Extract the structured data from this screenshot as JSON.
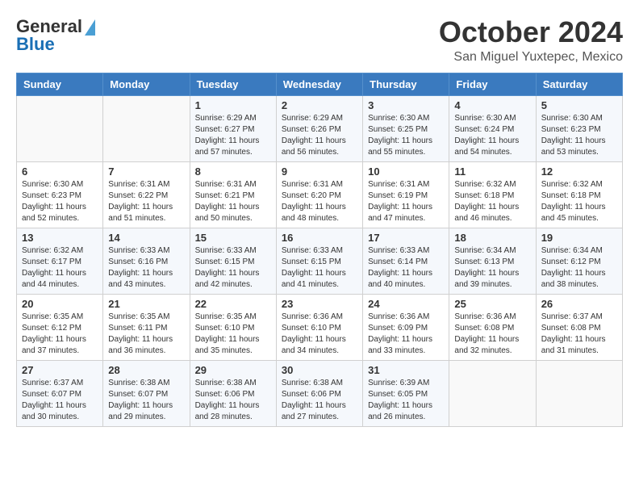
{
  "header": {
    "logo_line1": "General",
    "logo_line2": "Blue",
    "month_title": "October 2024",
    "subtitle": "San Miguel Yuxtepec, Mexico"
  },
  "weekdays": [
    "Sunday",
    "Monday",
    "Tuesday",
    "Wednesday",
    "Thursday",
    "Friday",
    "Saturday"
  ],
  "weeks": [
    [
      {
        "day": "",
        "info": ""
      },
      {
        "day": "",
        "info": ""
      },
      {
        "day": "1",
        "info": "Sunrise: 6:29 AM\nSunset: 6:27 PM\nDaylight: 11 hours and 57 minutes."
      },
      {
        "day": "2",
        "info": "Sunrise: 6:29 AM\nSunset: 6:26 PM\nDaylight: 11 hours and 56 minutes."
      },
      {
        "day": "3",
        "info": "Sunrise: 6:30 AM\nSunset: 6:25 PM\nDaylight: 11 hours and 55 minutes."
      },
      {
        "day": "4",
        "info": "Sunrise: 6:30 AM\nSunset: 6:24 PM\nDaylight: 11 hours and 54 minutes."
      },
      {
        "day": "5",
        "info": "Sunrise: 6:30 AM\nSunset: 6:23 PM\nDaylight: 11 hours and 53 minutes."
      }
    ],
    [
      {
        "day": "6",
        "info": "Sunrise: 6:30 AM\nSunset: 6:23 PM\nDaylight: 11 hours and 52 minutes."
      },
      {
        "day": "7",
        "info": "Sunrise: 6:31 AM\nSunset: 6:22 PM\nDaylight: 11 hours and 51 minutes."
      },
      {
        "day": "8",
        "info": "Sunrise: 6:31 AM\nSunset: 6:21 PM\nDaylight: 11 hours and 50 minutes."
      },
      {
        "day": "9",
        "info": "Sunrise: 6:31 AM\nSunset: 6:20 PM\nDaylight: 11 hours and 48 minutes."
      },
      {
        "day": "10",
        "info": "Sunrise: 6:31 AM\nSunset: 6:19 PM\nDaylight: 11 hours and 47 minutes."
      },
      {
        "day": "11",
        "info": "Sunrise: 6:32 AM\nSunset: 6:18 PM\nDaylight: 11 hours and 46 minutes."
      },
      {
        "day": "12",
        "info": "Sunrise: 6:32 AM\nSunset: 6:18 PM\nDaylight: 11 hours and 45 minutes."
      }
    ],
    [
      {
        "day": "13",
        "info": "Sunrise: 6:32 AM\nSunset: 6:17 PM\nDaylight: 11 hours and 44 minutes."
      },
      {
        "day": "14",
        "info": "Sunrise: 6:33 AM\nSunset: 6:16 PM\nDaylight: 11 hours and 43 minutes."
      },
      {
        "day": "15",
        "info": "Sunrise: 6:33 AM\nSunset: 6:15 PM\nDaylight: 11 hours and 42 minutes."
      },
      {
        "day": "16",
        "info": "Sunrise: 6:33 AM\nSunset: 6:15 PM\nDaylight: 11 hours and 41 minutes."
      },
      {
        "day": "17",
        "info": "Sunrise: 6:33 AM\nSunset: 6:14 PM\nDaylight: 11 hours and 40 minutes."
      },
      {
        "day": "18",
        "info": "Sunrise: 6:34 AM\nSunset: 6:13 PM\nDaylight: 11 hours and 39 minutes."
      },
      {
        "day": "19",
        "info": "Sunrise: 6:34 AM\nSunset: 6:12 PM\nDaylight: 11 hours and 38 minutes."
      }
    ],
    [
      {
        "day": "20",
        "info": "Sunrise: 6:35 AM\nSunset: 6:12 PM\nDaylight: 11 hours and 37 minutes."
      },
      {
        "day": "21",
        "info": "Sunrise: 6:35 AM\nSunset: 6:11 PM\nDaylight: 11 hours and 36 minutes."
      },
      {
        "day": "22",
        "info": "Sunrise: 6:35 AM\nSunset: 6:10 PM\nDaylight: 11 hours and 35 minutes."
      },
      {
        "day": "23",
        "info": "Sunrise: 6:36 AM\nSunset: 6:10 PM\nDaylight: 11 hours and 34 minutes."
      },
      {
        "day": "24",
        "info": "Sunrise: 6:36 AM\nSunset: 6:09 PM\nDaylight: 11 hours and 33 minutes."
      },
      {
        "day": "25",
        "info": "Sunrise: 6:36 AM\nSunset: 6:08 PM\nDaylight: 11 hours and 32 minutes."
      },
      {
        "day": "26",
        "info": "Sunrise: 6:37 AM\nSunset: 6:08 PM\nDaylight: 11 hours and 31 minutes."
      }
    ],
    [
      {
        "day": "27",
        "info": "Sunrise: 6:37 AM\nSunset: 6:07 PM\nDaylight: 11 hours and 30 minutes."
      },
      {
        "day": "28",
        "info": "Sunrise: 6:38 AM\nSunset: 6:07 PM\nDaylight: 11 hours and 29 minutes."
      },
      {
        "day": "29",
        "info": "Sunrise: 6:38 AM\nSunset: 6:06 PM\nDaylight: 11 hours and 28 minutes."
      },
      {
        "day": "30",
        "info": "Sunrise: 6:38 AM\nSunset: 6:06 PM\nDaylight: 11 hours and 27 minutes."
      },
      {
        "day": "31",
        "info": "Sunrise: 6:39 AM\nSunset: 6:05 PM\nDaylight: 11 hours and 26 minutes."
      },
      {
        "day": "",
        "info": ""
      },
      {
        "day": "",
        "info": ""
      }
    ]
  ]
}
